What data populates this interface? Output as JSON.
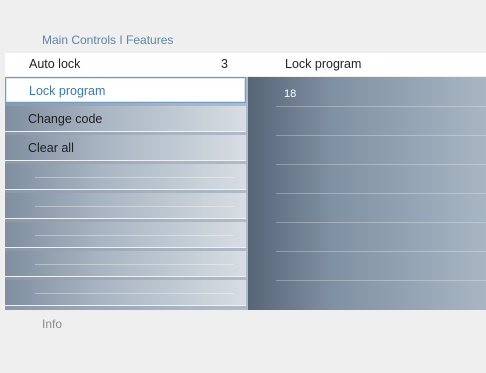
{
  "breadcrumb": "Main Controls I Features",
  "header": {
    "left_label": "Auto lock",
    "left_value": "3",
    "right_label": "Lock program"
  },
  "menu": {
    "items": [
      {
        "label": "Lock program",
        "selected": true
      },
      {
        "label": "Change code"
      },
      {
        "label": "Clear all"
      },
      {
        "label": ""
      },
      {
        "label": ""
      },
      {
        "label": ""
      },
      {
        "label": ""
      },
      {
        "label": ""
      }
    ]
  },
  "detail": {
    "value": "18"
  },
  "footer": {
    "label": "Info"
  },
  "colors": {
    "accent": "#3b78b0",
    "breadcrumb": "#5b87a6"
  }
}
